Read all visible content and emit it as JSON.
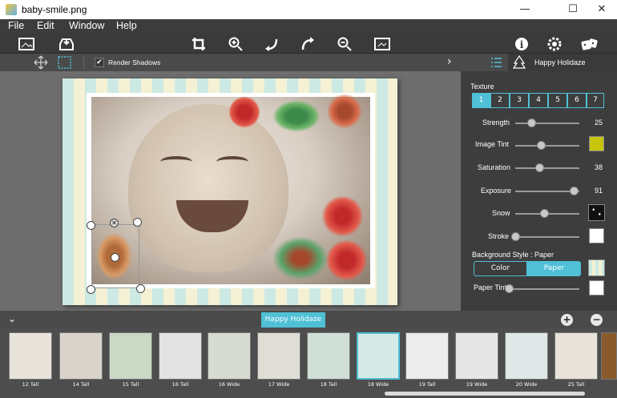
{
  "window": {
    "title": "baby-smile.png",
    "min": "—",
    "max": "☐",
    "close": "✕"
  },
  "menu": [
    "File",
    "Edit",
    "Window",
    "Help"
  ],
  "toolbar2": {
    "render_shadows": "Render Shadows",
    "checked_mark": "✔"
  },
  "panel": {
    "tab_name": "Happy Holidaze",
    "texture_label": "Texture",
    "texture_tabs": [
      "1",
      "2",
      "3",
      "4",
      "5",
      "6",
      "7"
    ],
    "texture_selected": "1",
    "strength_label": "Strength",
    "strength_value": "25",
    "strength_level": 0.25,
    "image_tint_label": "Image Tint",
    "image_tint_color": "#c7c40e",
    "image_tint_level": 0.4,
    "saturation_label": "Saturation",
    "saturation_value": "38",
    "saturation_level": 0.38,
    "exposure_label": "Exposure",
    "exposure_value": "91",
    "exposure_level": 0.91,
    "snow_label": "Snow",
    "snow_level": 0.45,
    "stroke_label": "Stroke",
    "stroke_level": 0.0,
    "bg_style_label": "Background Style : Paper",
    "bg_color_btn": "Color",
    "bg_paper_btn": "Paper",
    "paper_tint_label": "Paper Tint",
    "paper_tint_level": 0.0
  },
  "bottom": {
    "theme_tag": "Happy Holidaze",
    "add": "+",
    "remove": "−",
    "thumbs": [
      "12 Tall",
      "14 Tall",
      "15 Tall",
      "16 Tall",
      "16 Wide",
      "17 Wide",
      "18 Tall",
      "18 Wide",
      "19 Tall",
      "19 Wide",
      "20 Wide",
      "25 Tall"
    ]
  },
  "colors": {
    "accent": "#4fc0d6",
    "dark": "#3d3d3d"
  }
}
